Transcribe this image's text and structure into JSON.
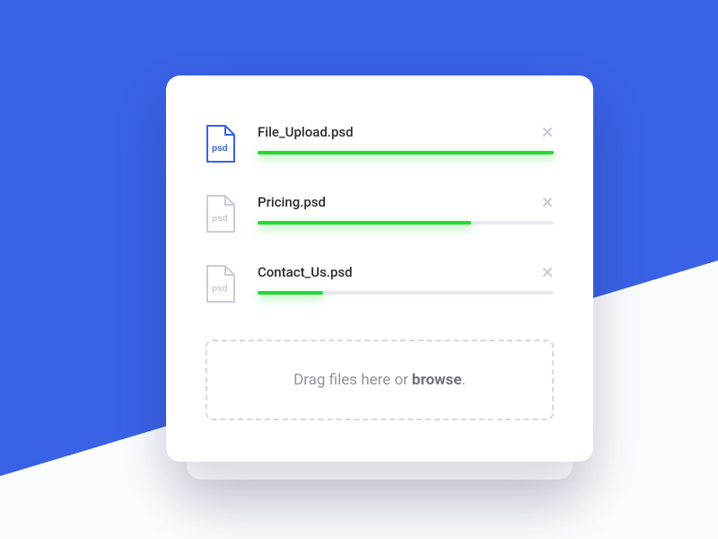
{
  "colors": {
    "accent": "#3a62e6",
    "progress": "#25d934",
    "muted_icon": "#c8ccd4",
    "text": "#2b2d31",
    "dropzone_text": "#8d939e"
  },
  "files": [
    {
      "name": "File_Upload.psd",
      "ext_label": "psd",
      "progress_pct": 100,
      "active": true
    },
    {
      "name": "Pricing.psd",
      "ext_label": "psd",
      "progress_pct": 72,
      "active": false
    },
    {
      "name": "Contact_Us.psd",
      "ext_label": "psd",
      "progress_pct": 22,
      "active": false
    }
  ],
  "dropzone": {
    "text_prefix": "Drag files here or ",
    "browse_label": "browse",
    "text_suffix": "."
  }
}
